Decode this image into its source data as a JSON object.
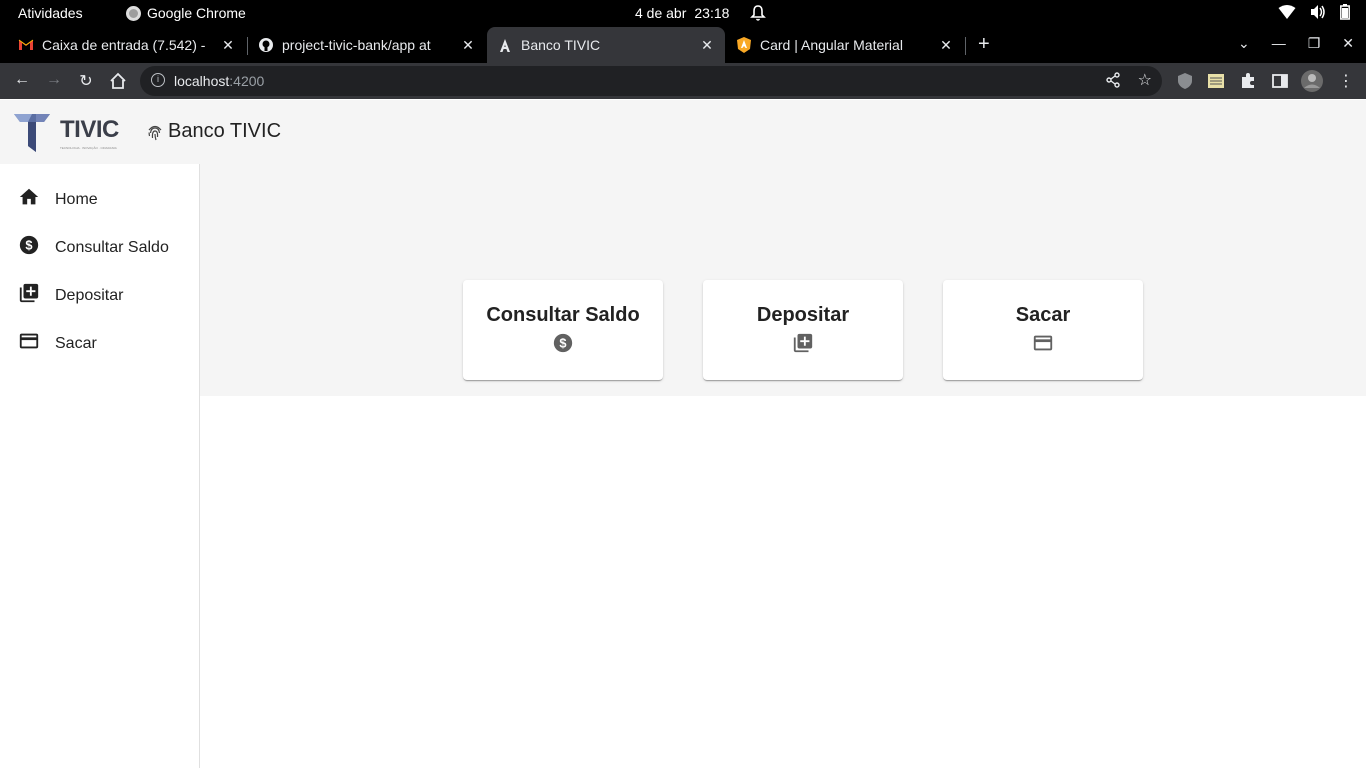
{
  "os_bar": {
    "activities": "Atividades",
    "app_name": "Google Chrome",
    "date": "4 de abr",
    "time": "23:18"
  },
  "tabs": [
    {
      "title": "Caixa de entrada (7.542) -",
      "favicon": "gmail-icon"
    },
    {
      "title": "project-tivic-bank/app at",
      "favicon": "github-icon"
    },
    {
      "title": "Banco TIVIC",
      "favicon": "angular-icon",
      "active": true
    },
    {
      "title": "Card | Angular Material",
      "favicon": "angular-material-icon"
    }
  ],
  "address_bar": {
    "host": "localhost",
    "port": ":4200"
  },
  "header": {
    "logo_text": "TIVIC",
    "logo_tagline": "TECNOLOGIA · INOVAÇÃO · CIDADANIA",
    "app_title": "Banco TIVIC"
  },
  "sidebar": {
    "items": [
      {
        "label": "Home",
        "icon": "home-icon"
      },
      {
        "label": "Consultar Saldo",
        "icon": "dollar-icon"
      },
      {
        "label": "Depositar",
        "icon": "library-add-icon"
      },
      {
        "label": "Sacar",
        "icon": "credit-card-icon"
      }
    ]
  },
  "cards": [
    {
      "title": "Consultar Saldo",
      "icon": "dollar-icon"
    },
    {
      "title": "Depositar",
      "icon": "library-add-icon"
    },
    {
      "title": "Sacar",
      "icon": "credit-card-icon"
    }
  ],
  "colors": {
    "os_bar": "#000000",
    "chrome_toolbar": "#35363a",
    "header_bg": "#f5f5f5",
    "icon_gray": "#616161"
  }
}
